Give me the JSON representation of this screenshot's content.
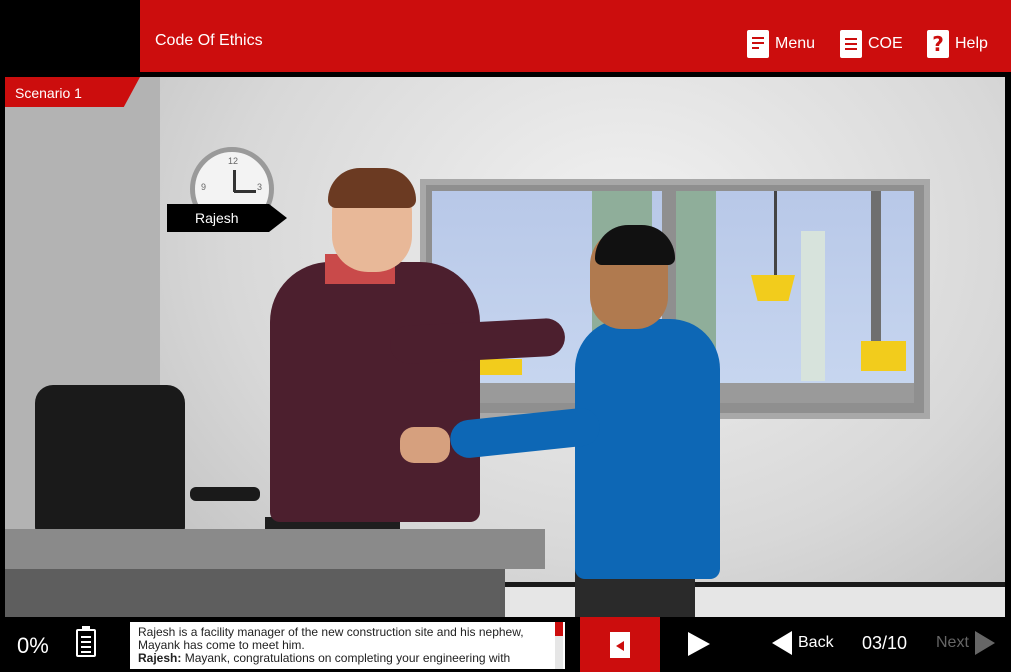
{
  "header": {
    "course_title": "Code Of Ethics",
    "menu_label": "Menu",
    "coe_label": "COE",
    "help_label": "Help",
    "help_glyph": "?"
  },
  "stage": {
    "scenario_label": "Scenario 1",
    "character_name": "Rajesh",
    "clock_numbers": [
      "12",
      "9",
      "3"
    ]
  },
  "footer": {
    "progress_percent": "0%",
    "transcript": {
      "line1": "Rajesh is a facility manager of the new construction site and his nephew, Mayank has come to meet him.",
      "speaker": "Rajesh:",
      "line2": " Mayank, congratulations on completing your engineering with"
    },
    "back_label": "Back",
    "page_indicator": "03/10",
    "next_label": "Next"
  },
  "colors": {
    "brand_red": "#cc0d0d",
    "shirt_blue": "#0d67b5",
    "sweater_maroon": "#4c1f2e"
  }
}
